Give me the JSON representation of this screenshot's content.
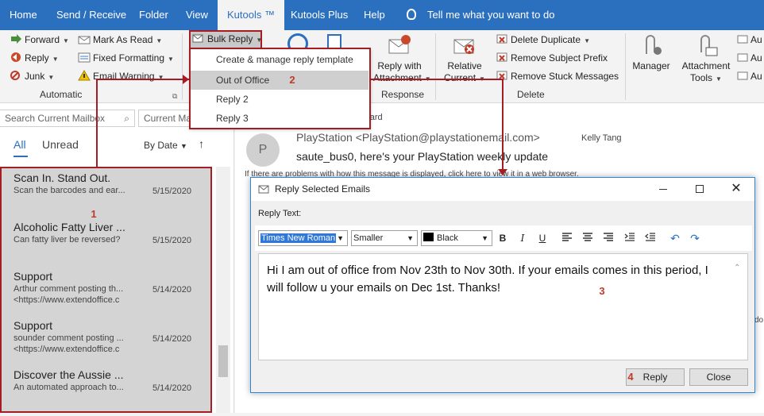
{
  "tabs": [
    "Home",
    "Send / Receive",
    "Folder",
    "View",
    "Kutools ™",
    "Kutools Plus",
    "Help"
  ],
  "tell_me": "Tell me what you want to do",
  "ribbon": {
    "forward": "Forward",
    "reply": "Reply",
    "junk": "Junk",
    "mark_as_read": "Mark As Read",
    "fixed_formatting": "Fixed Formatting",
    "email_warning": "Email Warning",
    "automatic_label": "Automatic",
    "bulk_reply": "Bulk Reply",
    "reply_with_attachment": [
      "Reply with",
      "Attachment"
    ],
    "relative_current": [
      "Relative",
      "Current"
    ],
    "response_label": "Response",
    "delete_duplicate": "Delete Duplicate",
    "remove_subject_prefix": "Remove Subject Prefix",
    "remove_stuck_messages": "Remove Stuck Messages",
    "delete_label": "Delete",
    "manager": "Manager",
    "attachment_tools": [
      "Attachment",
      "Tools"
    ],
    "au_items": [
      "Au",
      "Au",
      "Au"
    ]
  },
  "dropdown": {
    "items": [
      "Create & manage reply template",
      "Out of Office",
      "Reply 2",
      "Reply 3"
    ]
  },
  "left": {
    "search_placeholder": "Search Current Mailbox",
    "search_scope": "Current Ma",
    "filter_all": "All",
    "filter_unread": "Unread",
    "sort": "By Date",
    "emails": [
      {
        "title": "Scan In. Stand Out.",
        "sub": "Scan the barcodes and ear...",
        "sub2": "",
        "date": "5/15/2020"
      },
      {
        "title": "Alcoholic Fatty Liver ...",
        "sub": "Can fatty liver be reversed?",
        "sub2": "",
        "date": "5/15/2020"
      },
      {
        "title": "Support",
        "sub": "Arthur comment posting th...",
        "sub2": "<https://www.extendoffice.c",
        "date": "5/14/2020"
      },
      {
        "title": "Support",
        "sub": "sounder comment posting ...",
        "sub2": "<https://www.extendoffice.c",
        "date": "5/14/2020"
      },
      {
        "title": "Discover the Aussie ...",
        "sub": "An automated approach to...",
        "sub2": "",
        "date": "5/14/2020"
      }
    ]
  },
  "reading": {
    "forward_label": "orward",
    "avatar_initial": "P",
    "sender": "PlayStation <PlayStation@playstationemail.com>",
    "recipient": "Kelly Tang",
    "subject": "saute_bus0, here's your PlayStation weekly update",
    "info_bar": "If there are problems with how this message is displayed, click here to view it in a web browser.",
    "side_fragment": "do"
  },
  "dialog": {
    "title": "Reply Selected Emails",
    "reply_text_label": "Reply Text:",
    "font": "Times New Roman",
    "size": "Smaller",
    "color": "Black",
    "body": "Hi I am out of office from Nov 23th to Nov 30th. If your emails comes in this period, I will follow u your emails on Dec 1st. Thanks!",
    "reply_button": "Reply",
    "close_button": "Close"
  },
  "callouts": [
    "1",
    "2",
    "3",
    "4"
  ],
  "colors": {
    "brand": "#2b6fbf",
    "callout": "#a51c24",
    "dialog_border": "#2b88d8"
  }
}
